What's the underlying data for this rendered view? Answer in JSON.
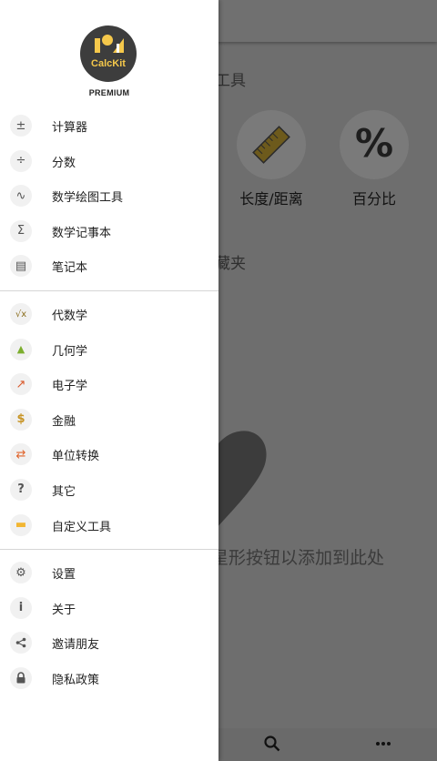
{
  "background": {
    "section_tools": "工具",
    "tools": [
      {
        "label": "长度/距离",
        "icon": "ruler-icon"
      },
      {
        "label": "百分比",
        "icon": "percent-icon"
      }
    ],
    "section_favorites": "藏夹",
    "favorites_hint": "星形按钮以添加到此处",
    "bottom_icons": [
      "search-icon",
      "more-icon"
    ]
  },
  "drawer": {
    "app_logo_text": "CalcKit",
    "badge": "PREMIUM",
    "groups": [
      [
        {
          "label": "计算器",
          "icon": "calculator-icon",
          "glyph": "±"
        },
        {
          "label": "分数",
          "icon": "divide-icon",
          "glyph": "÷"
        },
        {
          "label": "数学绘图工具",
          "icon": "graph-icon",
          "glyph": "∿"
        },
        {
          "label": "数学记事本",
          "icon": "sigma-icon",
          "glyph": "Σ"
        },
        {
          "label": "笔记本",
          "icon": "document-icon",
          "glyph": "▤"
        }
      ],
      [
        {
          "label": "代数学",
          "icon": "sqrt-icon",
          "glyph": "√x"
        },
        {
          "label": "几何学",
          "icon": "geometry-icon",
          "glyph": "▲"
        },
        {
          "label": "电子学",
          "icon": "electronics-icon",
          "glyph": "↗"
        },
        {
          "label": "金融",
          "icon": "money-bag-icon",
          "glyph": "$"
        },
        {
          "label": "单位转换",
          "icon": "convert-icon",
          "glyph": "⇄"
        },
        {
          "label": "其它",
          "icon": "question-icon",
          "glyph": "?"
        },
        {
          "label": "自定义工具",
          "icon": "folder-icon",
          "glyph": "▬"
        }
      ],
      [
        {
          "label": "设置",
          "icon": "gear-icon",
          "glyph": "⚙"
        },
        {
          "label": "关于",
          "icon": "info-icon",
          "glyph": "i"
        },
        {
          "label": "邀请朋友",
          "icon": "share-icon",
          "glyph": "≺"
        },
        {
          "label": "隐私政策",
          "icon": "lock-icon",
          "glyph": "🔒"
        }
      ]
    ]
  },
  "colors": {
    "drawer_bg": "#ffffff",
    "scrim": "#6e6e6e",
    "logo_bg": "#3d3d3d",
    "logo_accent": "#f5c84b",
    "icon_circle": "#f1f1f1"
  }
}
